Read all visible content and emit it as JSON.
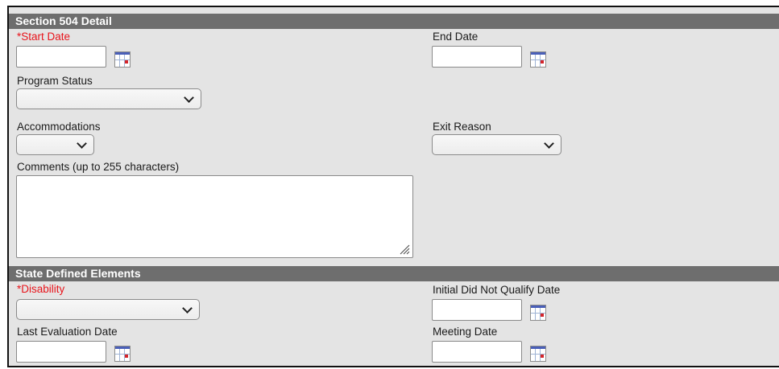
{
  "section_504": {
    "header": "Section 504 Detail",
    "start_date": {
      "required_mark": "*",
      "label": "Start Date",
      "value": ""
    },
    "end_date": {
      "label": "End Date",
      "value": ""
    },
    "program_status": {
      "label": "Program Status",
      "selected": ""
    },
    "accommodations": {
      "label": "Accommodations",
      "selected": ""
    },
    "exit_reason": {
      "label": "Exit Reason",
      "selected": ""
    },
    "comments": {
      "label": "Comments (up to 255 characters)",
      "value": ""
    }
  },
  "state_defined": {
    "header": "State Defined Elements",
    "disability": {
      "required_mark": "*",
      "label": "Disability",
      "selected": ""
    },
    "initial_dnq_date": {
      "label": "Initial Did Not Qualify Date",
      "value": ""
    },
    "last_evaluation_date": {
      "label": "Last Evaluation Date",
      "value": ""
    },
    "meeting_date": {
      "label": "Meeting Date",
      "value": ""
    }
  },
  "icons": {
    "calendar": "calendar-icon",
    "dropdown": "chevron-down-icon",
    "resize": "resize-grip-icon"
  },
  "colors": {
    "header_bg": "#6e6e6e",
    "panel_bg": "#e4e4e4",
    "required": "#e8141b"
  }
}
